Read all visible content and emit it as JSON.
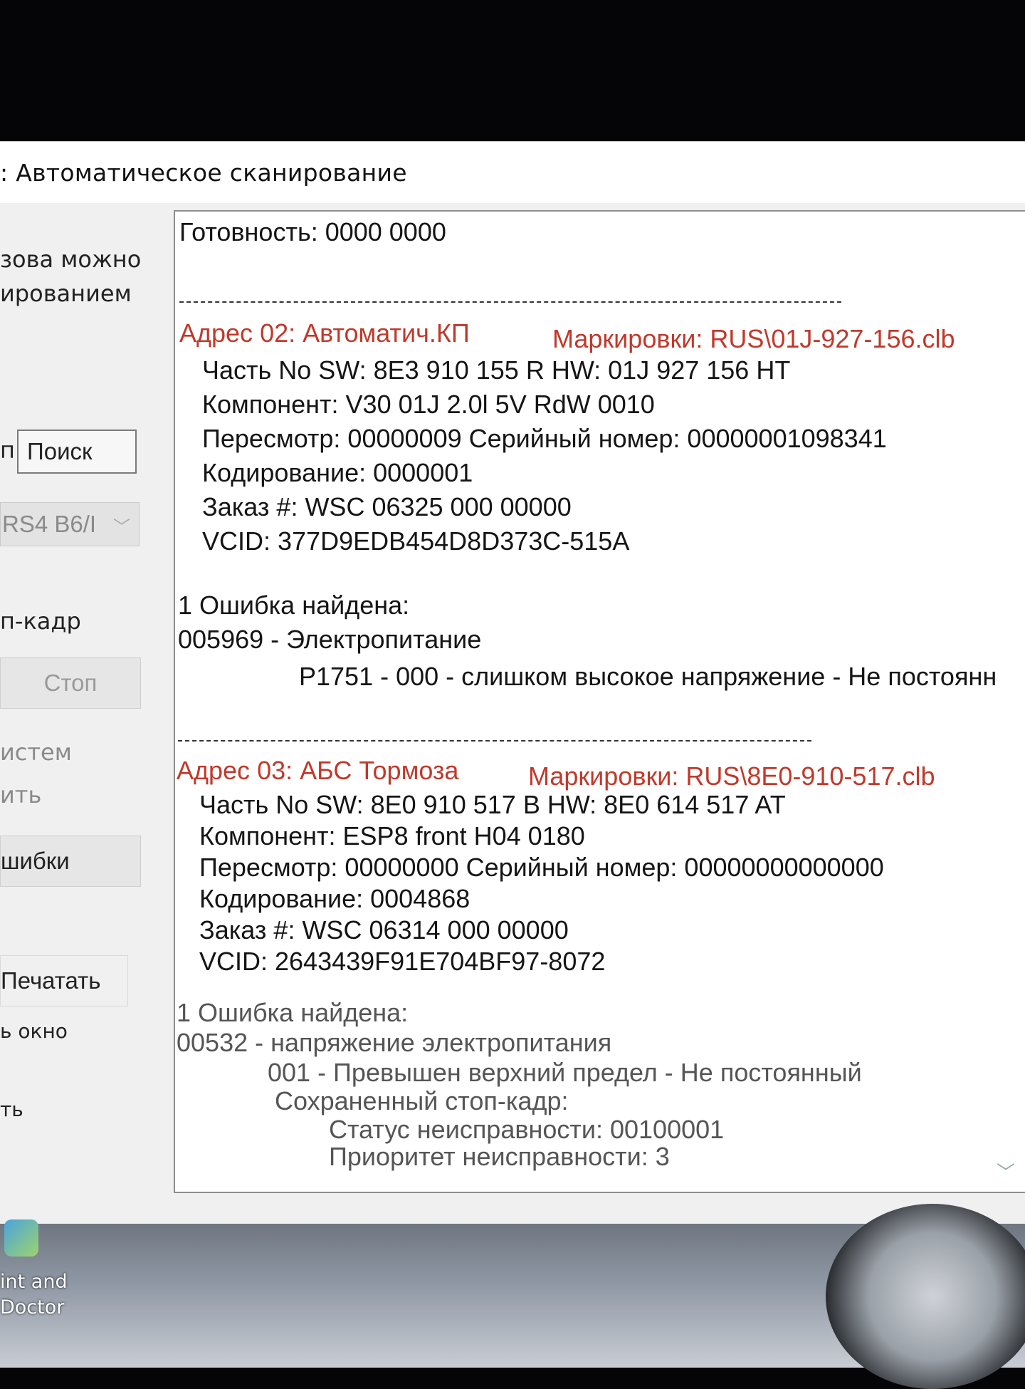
{
  "window": {
    "title": ": Автоматическое сканирование"
  },
  "left_panel": {
    "text_1": "зова можно",
    "text_2": "ированием",
    "search_prefix": "п",
    "search_label": "Поиск",
    "model_select_value": "RS4 B6/I",
    "freeze_frame_label": "п-кадр",
    "stop_label": "Стоп",
    "systems_label": "истем",
    "clear_label": "ить",
    "errors_label": "шибки",
    "print_label": "Печатать",
    "window_label": "ь окно",
    "exit_label": "ть"
  },
  "log": {
    "readiness": "Готовность: 0000 0000",
    "modules": [
      {
        "address": "Адрес 02: Автоматич.КП",
        "labels": "Маркировки: RUS\\01J-927-156.clb",
        "part_no": "Часть No SW: 8E3 910 155 R    HW: 01J 927 156 HT",
        "component": "Компонент: V30 01J 2.0l 5V RdW 0010",
        "revision": "Пересмотр: 00000009    Серийный номер: 00000001098341",
        "coding": "Кодирование: 0000001",
        "order": "Заказ #: WSC 06325 000 00000",
        "vcid": "VCID: 377D9EDB454D8D373C-515A",
        "fault_count": "1 Ошибка найдена:",
        "fault_code": "005969 - Электропитание",
        "fault_detail": "P1751 - 000 - слишком высокое напряжение - Не постоянн"
      },
      {
        "address": "Адрес 03: АБС Тормоза",
        "labels": "Маркировки: RUS\\8E0-910-517.clb",
        "part_no": "Часть No SW: 8E0 910 517 B    HW: 8E0 614 517 AT",
        "component": "Компонент: ESP8 front      H04 0180",
        "revision": "Пересмотр: 00000000    Серийный номер: 00000000000000",
        "coding": "Кодирование: 0004868",
        "order": "Заказ #: WSC 06314 000 00000",
        "vcid": "VCID: 2643439F91E704BF97-8072",
        "fault_count": "1 Ошибка найдена:",
        "fault_code": "00532 - напряжение электропитания",
        "fault_detail": "001 - Превышен верхний предел - Не постоянный",
        "freeze_frame": "Сохраненный стоп-кадр:",
        "fault_status": "Статус неисправности: 00100001",
        "fault_priority": "Приоритет неисправности: 3"
      }
    ]
  },
  "desktop": {
    "icon_label_1": "int and",
    "icon_label_2": "Doctor"
  },
  "colors": {
    "module_header": "#c0392b",
    "text": "#151515"
  }
}
